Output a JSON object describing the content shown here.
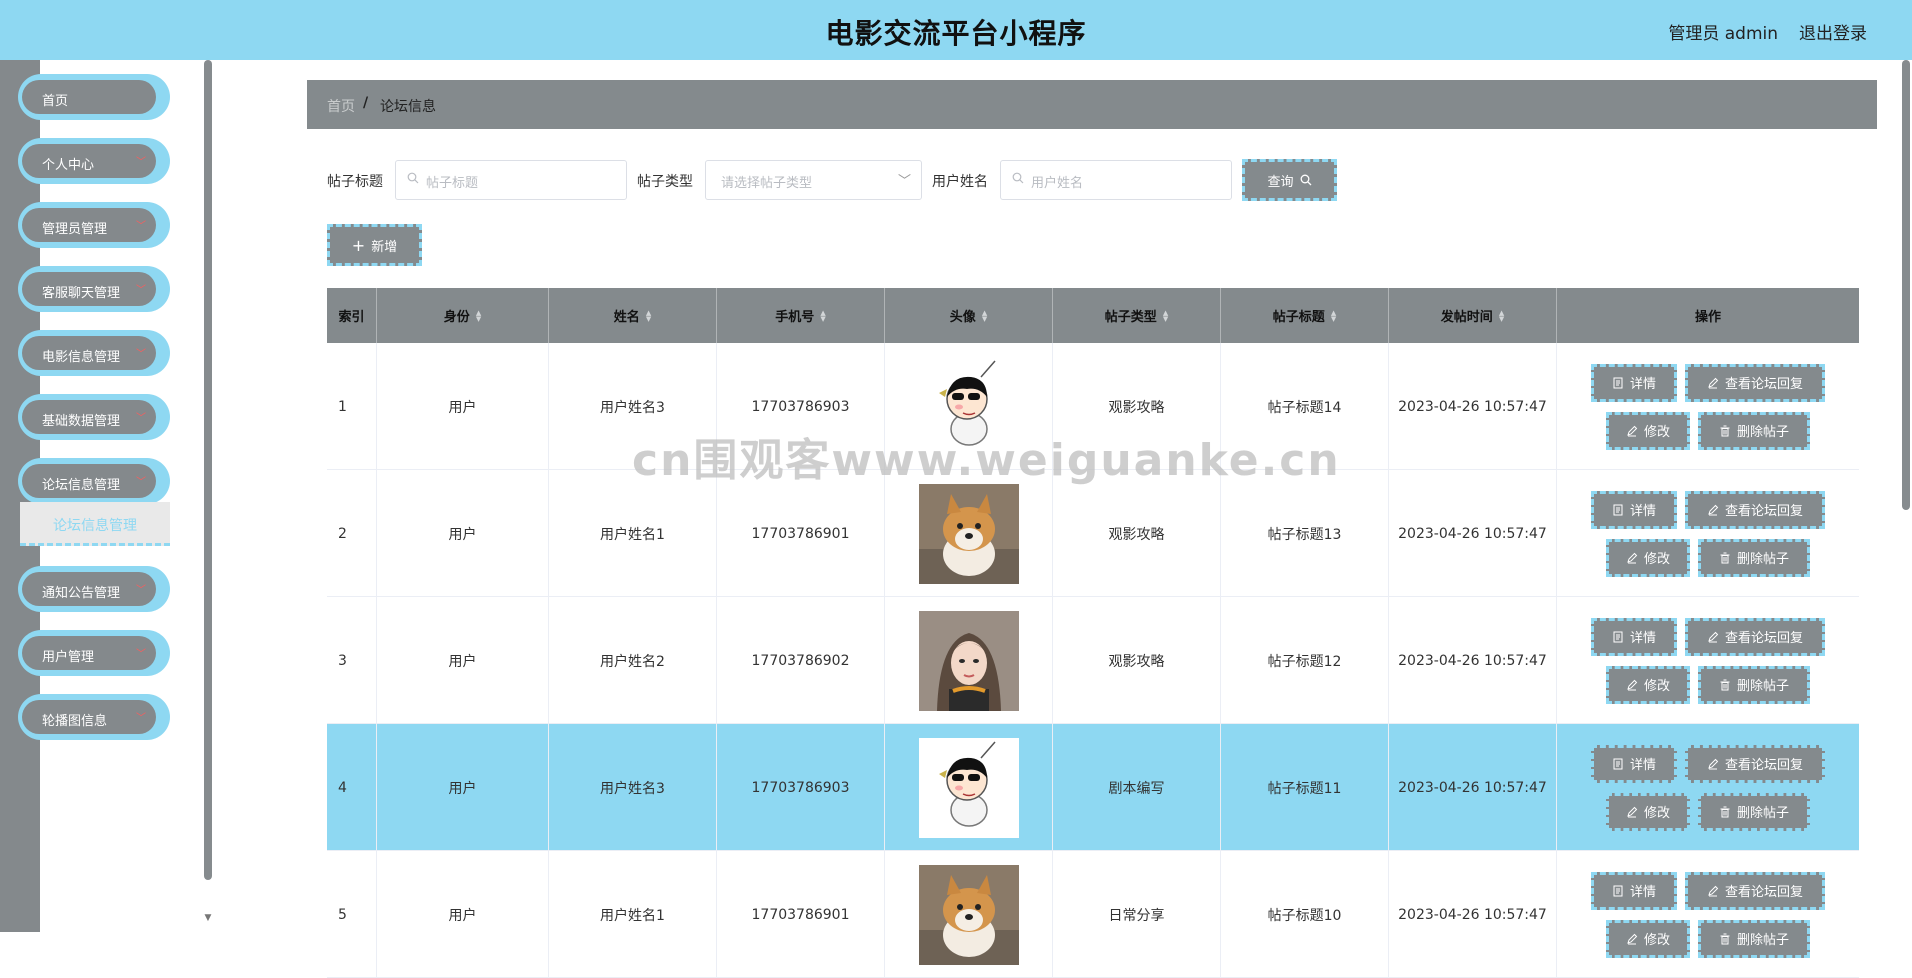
{
  "header": {
    "title": "电影交流平台小程序",
    "user": "管理员 admin",
    "logout": "退出登录"
  },
  "sidebar": {
    "items": [
      {
        "label": "首页",
        "expandable": false
      },
      {
        "label": "个人中心",
        "expandable": true
      },
      {
        "label": "管理员管理",
        "expandable": true
      },
      {
        "label": "客服聊天管理",
        "expandable": true
      },
      {
        "label": "电影信息管理",
        "expandable": true
      },
      {
        "label": "基础数据管理",
        "expandable": true
      },
      {
        "label": "论坛信息管理",
        "expandable": true
      },
      {
        "label": "通知公告管理",
        "expandable": true
      },
      {
        "label": "用户管理",
        "expandable": true
      },
      {
        "label": "轮播图信息",
        "expandable": true
      }
    ],
    "active_sub": "论坛信息管理"
  },
  "breadcrumb": {
    "home": "首页",
    "separator": "/",
    "current": "论坛信息"
  },
  "filters": {
    "title_label": "帖子标题",
    "title_placeholder": "帖子标题",
    "type_label": "帖子类型",
    "type_placeholder": "请选择帖子类型",
    "user_label": "用户姓名",
    "user_placeholder": "用户姓名",
    "query_button": "查询",
    "add_button": "新增"
  },
  "table": {
    "columns": [
      "索引",
      "身份",
      "姓名",
      "手机号",
      "头像",
      "帖子类型",
      "帖子标题",
      "发帖时间",
      "操作"
    ],
    "rows": [
      {
        "index": "1",
        "role": "用户",
        "name": "用户姓名3",
        "phone": "17703786903",
        "avatar": "cartoon-boy",
        "type": "观影攻略",
        "title": "帖子标题14",
        "time": "2023-04-26 10:57:47",
        "highlighted": false
      },
      {
        "index": "2",
        "role": "用户",
        "name": "用户姓名1",
        "phone": "17703786901",
        "avatar": "shiba-dog",
        "type": "观影攻略",
        "title": "帖子标题13",
        "time": "2023-04-26 10:57:47",
        "highlighted": false
      },
      {
        "index": "3",
        "role": "用户",
        "name": "用户姓名2",
        "phone": "17703786902",
        "avatar": "girl-portrait",
        "type": "观影攻略",
        "title": "帖子标题12",
        "time": "2023-04-26 10:57:47",
        "highlighted": false
      },
      {
        "index": "4",
        "role": "用户",
        "name": "用户姓名3",
        "phone": "17703786903",
        "avatar": "cartoon-boy",
        "type": "剧本编写",
        "title": "帖子标题11",
        "time": "2023-04-26 10:57:47",
        "highlighted": true
      },
      {
        "index": "5",
        "role": "用户",
        "name": "用户姓名1",
        "phone": "17703786901",
        "avatar": "shiba-dog",
        "type": "日常分享",
        "title": "帖子标题10",
        "time": "2023-04-26 10:57:47",
        "highlighted": false
      }
    ],
    "actions": {
      "detail": "详情",
      "view_replies": "查看论坛回复",
      "edit": "修改",
      "delete": "删除帖子"
    }
  },
  "watermark": "cn围观客www.weiguanke.cn",
  "colors": {
    "accent": "#8ed8f2",
    "gray": "#848a8d"
  }
}
